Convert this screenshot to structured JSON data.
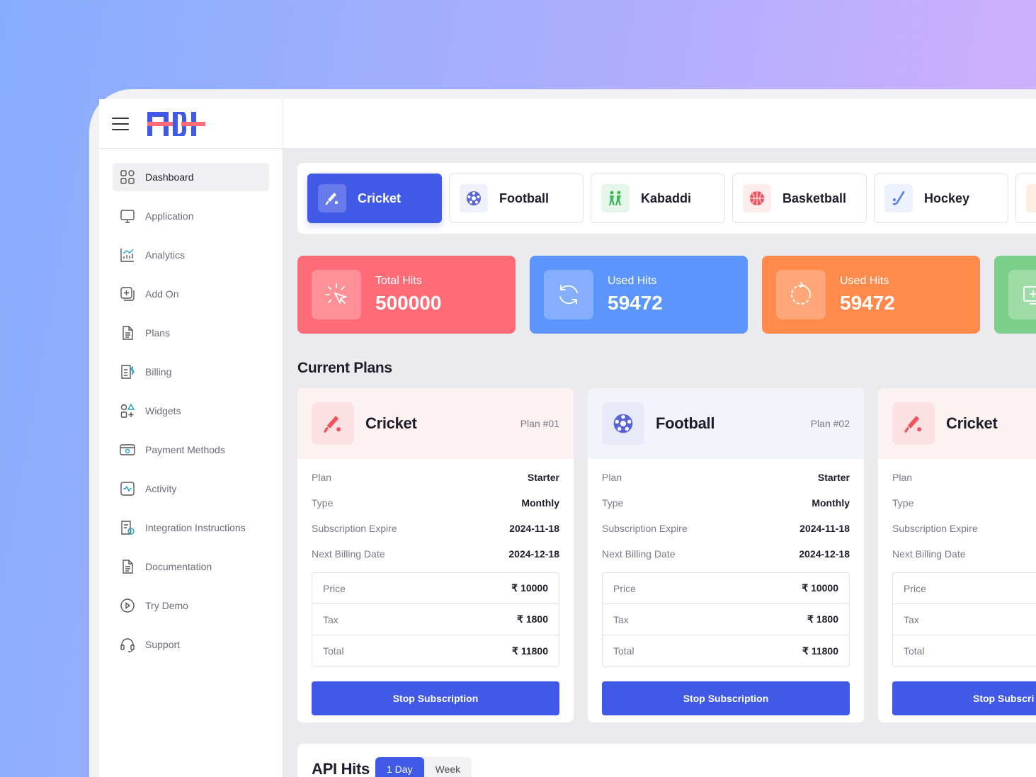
{
  "colors": {
    "primary": "#4059e6",
    "total_hits_card": "#ff6b76",
    "used_hits_card_blue": "#5c95fb",
    "used_hits_card_orange": "#ff8a4c",
    "green_card": "#7ccf8a",
    "cricket_accent": "#f0515a",
    "football_accent": "#5a63d8"
  },
  "sidebar": {
    "items": [
      {
        "label": "Dashboard",
        "icon": "grid-icon",
        "active": true
      },
      {
        "label": "Application",
        "icon": "monitor-icon"
      },
      {
        "label": "Analytics",
        "icon": "chart-icon"
      },
      {
        "label": "Add On",
        "icon": "add-on-icon"
      },
      {
        "label": "Plans",
        "icon": "document-icon"
      },
      {
        "label": "Billing",
        "icon": "billing-icon"
      },
      {
        "label": "Widgets",
        "icon": "widgets-icon"
      },
      {
        "label": "Payment Methods",
        "icon": "payment-icon"
      },
      {
        "label": "Activity",
        "icon": "activity-icon"
      },
      {
        "label": "Integration Instructions",
        "icon": "integration-icon"
      },
      {
        "label": "Documentation",
        "icon": "documentation-icon"
      },
      {
        "label": "Try Demo",
        "icon": "play-icon"
      },
      {
        "label": "Support",
        "icon": "headset-icon"
      }
    ]
  },
  "sports": [
    {
      "label": "Cricket",
      "icon": "cricket-icon",
      "active": true
    },
    {
      "label": "Football",
      "icon": "football-icon"
    },
    {
      "label": "Kabaddi",
      "icon": "kabaddi-icon"
    },
    {
      "label": "Basketball",
      "icon": "basketball-icon"
    },
    {
      "label": "Hockey",
      "icon": "hockey-icon"
    }
  ],
  "stats": [
    {
      "label": "Total Hits",
      "value": "500000",
      "icon": "cursor-click-icon"
    },
    {
      "label": "Used Hits",
      "value": "59472",
      "icon": "refresh-icon"
    },
    {
      "label": "Used Hits",
      "value": "59472",
      "icon": "loading-icon"
    }
  ],
  "current_plans": {
    "title": "Current Plans",
    "plans": [
      {
        "sport": "Cricket",
        "plan_no": "Plan #01",
        "icon": "cricket-icon",
        "rows": [
          {
            "k": "Plan",
            "v": "Starter"
          },
          {
            "k": "Type",
            "v": "Monthly"
          },
          {
            "k": "Subscription Expire",
            "v": "2024-11-18"
          },
          {
            "k": "Next Billing Date",
            "v": "2024-12-18"
          }
        ],
        "price": [
          {
            "k": "Price",
            "v": "₹ 10000"
          },
          {
            "k": "Tax",
            "v": "₹ 1800"
          },
          {
            "k": "Total",
            "v": "₹ 11800"
          }
        ],
        "button": "Stop Subscription"
      },
      {
        "sport": "Football",
        "plan_no": "Plan #02",
        "icon": "football-icon",
        "rows": [
          {
            "k": "Plan",
            "v": "Starter"
          },
          {
            "k": "Type",
            "v": "Monthly"
          },
          {
            "k": "Subscription Expire",
            "v": "2024-11-18"
          },
          {
            "k": "Next Billing Date",
            "v": "2024-12-18"
          }
        ],
        "price": [
          {
            "k": "Price",
            "v": "₹ 10000"
          },
          {
            "k": "Tax",
            "v": "₹ 1800"
          },
          {
            "k": "Total",
            "v": "₹ 11800"
          }
        ],
        "button": "Stop Subscription"
      },
      {
        "sport": "Cricket",
        "plan_no": "",
        "icon": "cricket-icon",
        "rows": [
          {
            "k": "Plan",
            "v": ""
          },
          {
            "k": "Type",
            "v": ""
          },
          {
            "k": "Subscription Expire",
            "v": ""
          },
          {
            "k": "Next Billing Date",
            "v": ""
          }
        ],
        "price": [
          {
            "k": "Price",
            "v": ""
          },
          {
            "k": "Tax",
            "v": ""
          },
          {
            "k": "Total",
            "v": ""
          }
        ],
        "button": "Stop Subscri"
      }
    ]
  },
  "api_hits": {
    "title": "API Hits",
    "ranges": [
      "1 Day",
      "Week"
    ],
    "active_range": "1 Day"
  }
}
